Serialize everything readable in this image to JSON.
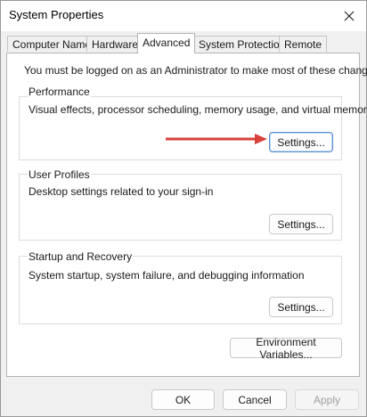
{
  "window": {
    "title": "System Properties",
    "close_icon": "close-icon"
  },
  "tabs": [
    {
      "label": "Computer Name",
      "active": false
    },
    {
      "label": "Hardware",
      "active": false
    },
    {
      "label": "Advanced",
      "active": true
    },
    {
      "label": "System Protection",
      "active": false
    },
    {
      "label": "Remote",
      "active": false
    }
  ],
  "advanced": {
    "admin_note": "You must be logged on as an Administrator to make most of these changes.",
    "performance": {
      "label": "Performance",
      "description": "Visual effects, processor scheduling, memory usage, and virtual memory",
      "button": "Settings..."
    },
    "user_profiles": {
      "label": "User Profiles",
      "description": "Desktop settings related to your sign-in",
      "button": "Settings..."
    },
    "startup_recovery": {
      "label": "Startup and Recovery",
      "description": "System startup, system failure, and debugging information",
      "button": "Settings..."
    },
    "env_button": "Environment Variables..."
  },
  "footer": {
    "ok": "OK",
    "cancel": "Cancel",
    "apply": "Apply"
  },
  "colors": {
    "annotation_arrow": "#d9413c",
    "focus_border": "#5a8fd0"
  }
}
